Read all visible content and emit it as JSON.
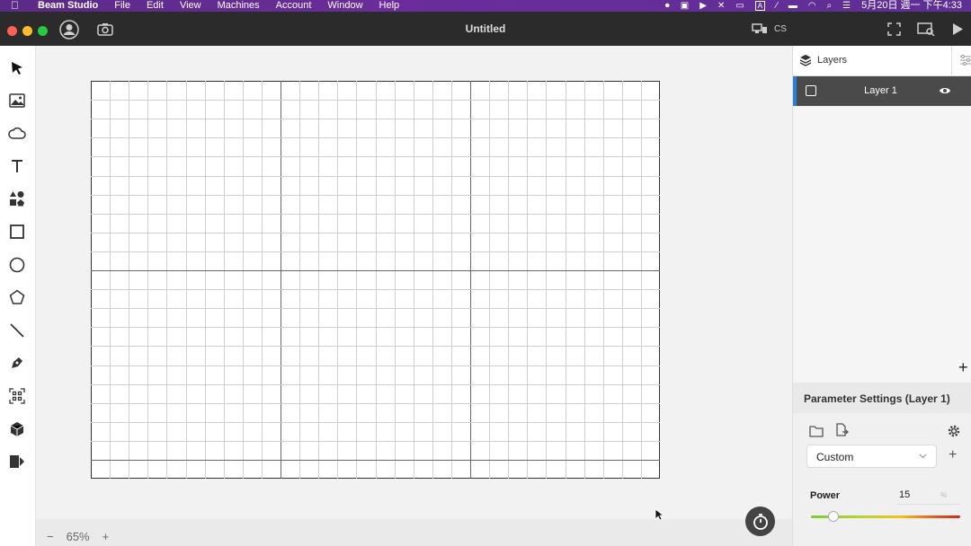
{
  "menubar": {
    "app_name": "Beam Studio",
    "items": [
      "File",
      "Edit",
      "View",
      "Machines",
      "Account",
      "Window",
      "Help"
    ],
    "clock": "5月20日 週一 下午4:33"
  },
  "window": {
    "title": "Untitled",
    "cs_label": "CS"
  },
  "tools": [
    "cursor-icon",
    "image-icon",
    "cloud-icon",
    "text-icon",
    "elements-icon",
    "rectangle-icon",
    "ellipse-icon",
    "polygon-icon",
    "line-icon",
    "pen-icon",
    "qr-code-icon",
    "box-icon",
    "dmkt-icon"
  ],
  "canvas": {
    "zoom": "65%",
    "zoom_minus": "−",
    "zoom_plus": "+"
  },
  "layers": {
    "header": "Layers",
    "items": [
      {
        "name": "Layer 1",
        "visible": true
      }
    ],
    "add_label": "+"
  },
  "parameters": {
    "header": "Parameter Settings (Layer 1)",
    "preset": "Custom",
    "add_label": "+",
    "power_label": "Power",
    "power_value": "15",
    "power_unit": "%",
    "power_fraction": 0.15
  },
  "colors": {
    "accent": "#2a7fd6",
    "titlebar": "#2b2b2b",
    "menubar": "#6a2d9b"
  }
}
